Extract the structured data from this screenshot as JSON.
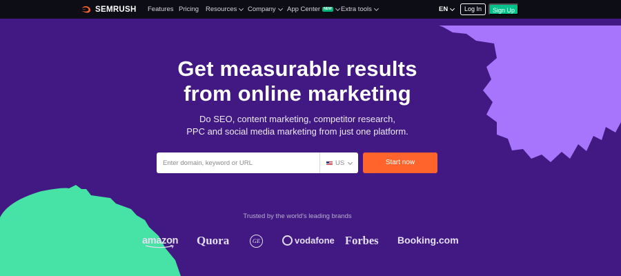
{
  "nav": {
    "brand": "SEMRUSH",
    "links": [
      "Features",
      "Pricing",
      "Resources",
      "Company",
      "App Center",
      "Extra tools"
    ],
    "app_center_badge": "NEW",
    "language": "EN",
    "login_label": "Log In",
    "signup_label": "Sign Up"
  },
  "hero": {
    "headline_line1": "Get measurable results",
    "headline_line2": "from online marketing",
    "subhead_line1": "Do SEO, content marketing, competitor research,",
    "subhead_line2": "PPC and social media marketing from just one platform."
  },
  "search": {
    "placeholder": "Enter domain, keyword or URL",
    "country": "US",
    "start_label": "Start now"
  },
  "brands": {
    "title": "Trusted by the world's leading brands",
    "items": [
      "amazon",
      "Quora",
      "GE",
      "vodafone",
      "Forbes",
      "Booking.com"
    ]
  },
  "colors": {
    "background": "#421983",
    "nav": "#0d0d16",
    "accent_orange": "#ff642d",
    "accent_green": "#00c28a",
    "shape_purple": "#a675fb",
    "shape_green": "#46e2a6"
  }
}
